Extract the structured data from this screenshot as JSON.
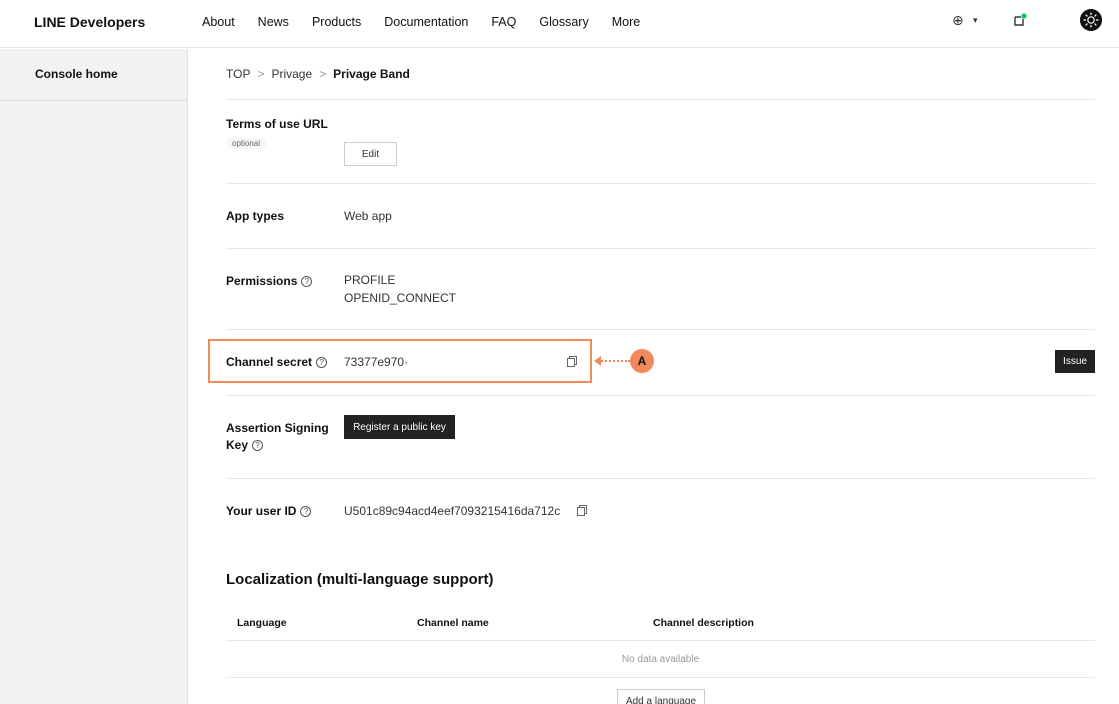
{
  "header": {
    "brand": "LINE Developers",
    "nav": [
      "About",
      "News",
      "Products",
      "Documentation",
      "FAQ",
      "Glossary",
      "More"
    ],
    "language_icon": "globe-icon",
    "language_caret": "▾",
    "notification_icon": "notification-icon",
    "avatar_icon": "avatar-icon"
  },
  "sidebar": {
    "items": [
      {
        "label": "Console home"
      }
    ]
  },
  "breadcrumb": {
    "items": [
      "TOP",
      "Privage"
    ],
    "separator": ">",
    "current": "Privage Band"
  },
  "settings": {
    "terms_of_use": {
      "label": "Terms of use URL",
      "badge": "optional",
      "edit_label": "Edit"
    },
    "app_types": {
      "label": "App types",
      "value": "Web app"
    },
    "permissions": {
      "label": "Permissions",
      "help": "?",
      "values": [
        "PROFILE",
        "OPENID_CONNECT"
      ]
    },
    "channel_secret": {
      "label": "Channel secret",
      "help": "?",
      "value": "73377e970·",
      "issue_label": "Issue"
    },
    "assertion_signing_key": {
      "label_line1": "Assertion Signing",
      "label_line2": "Key",
      "help": "?",
      "button_label": "Register a public key"
    },
    "user_id": {
      "label": "Your user ID",
      "help": "?",
      "value": "U501c89c94acd4eef7093215416da712c"
    }
  },
  "annotation": {
    "marker": "A",
    "color": "#f08a5d"
  },
  "localization": {
    "title": "Localization (multi-language support)",
    "columns": [
      "Language",
      "Channel name",
      "Channel description"
    ],
    "empty_text": "No data available",
    "add_label": "Add a language"
  }
}
